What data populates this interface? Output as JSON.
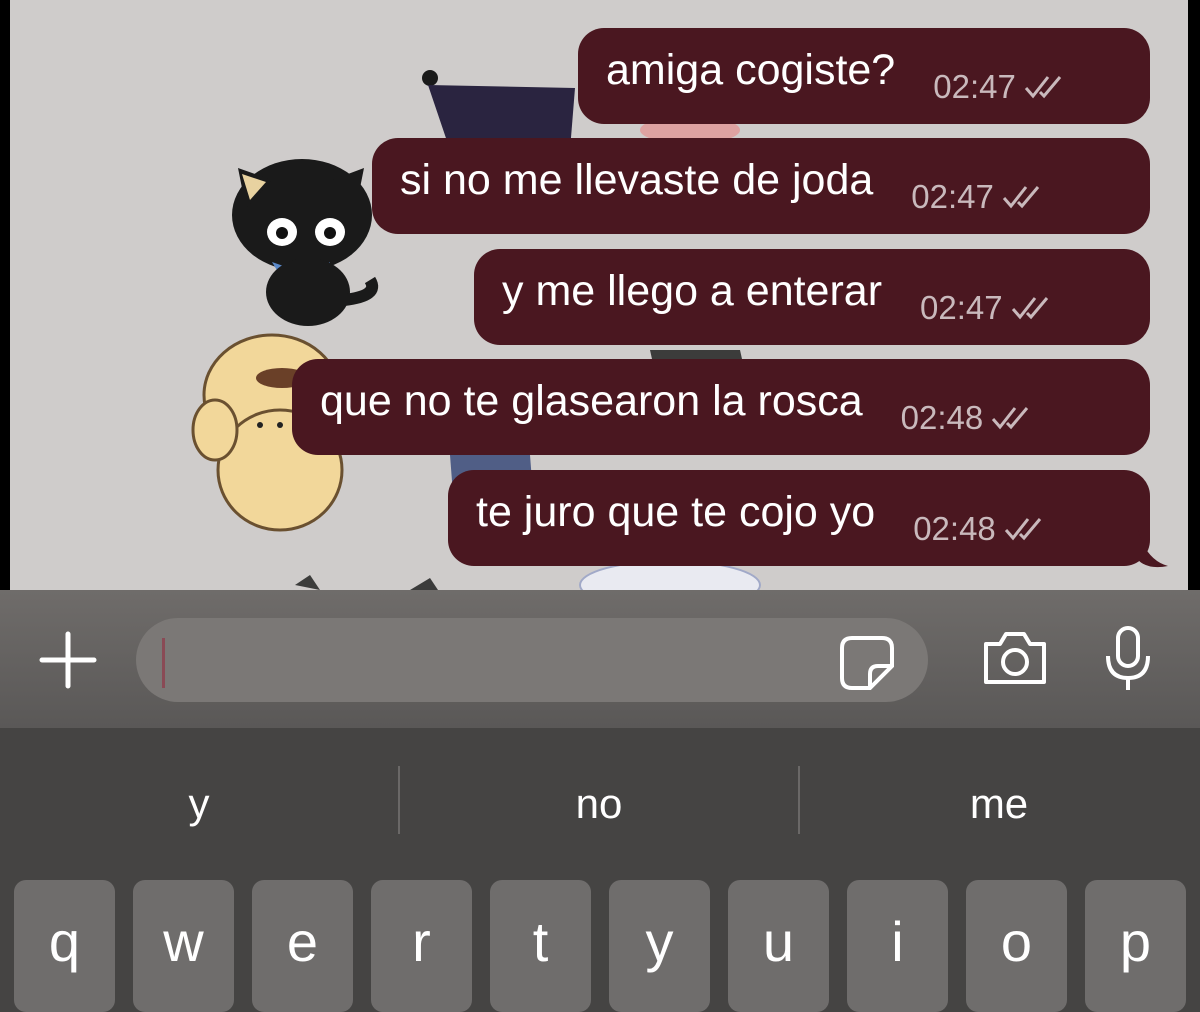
{
  "messages": [
    {
      "text": "amiga cogiste?",
      "time": "02:47",
      "status": "read-double-check-icon"
    },
    {
      "text": "si no me llevaste de joda",
      "time": "02:47",
      "status": "read-double-check-icon"
    },
    {
      "text": "y me llego a enterar",
      "time": "02:47",
      "status": "read-double-check-icon"
    },
    {
      "text": "que no te glasearon la rosca",
      "time": "02:48",
      "status": "read-double-check-icon"
    },
    {
      "text": "te juro que te cojo yo",
      "time": "02:48",
      "status": "read-double-check-icon"
    }
  ],
  "input": {
    "value": "",
    "placeholder": ""
  },
  "icons": {
    "add": "plus-icon",
    "sticker": "sticker-icon",
    "camera": "camera-icon",
    "mic": "microphone-icon"
  },
  "suggestions": [
    "y",
    "no",
    "me"
  ],
  "keys": [
    "q",
    "w",
    "e",
    "r",
    "t",
    "y",
    "u",
    "i",
    "o",
    "p"
  ],
  "colors": {
    "bubble": "#4a1720",
    "chat_bg": "#cfcccb",
    "keyboard": "#454443",
    "key": "#6f6d6c"
  }
}
